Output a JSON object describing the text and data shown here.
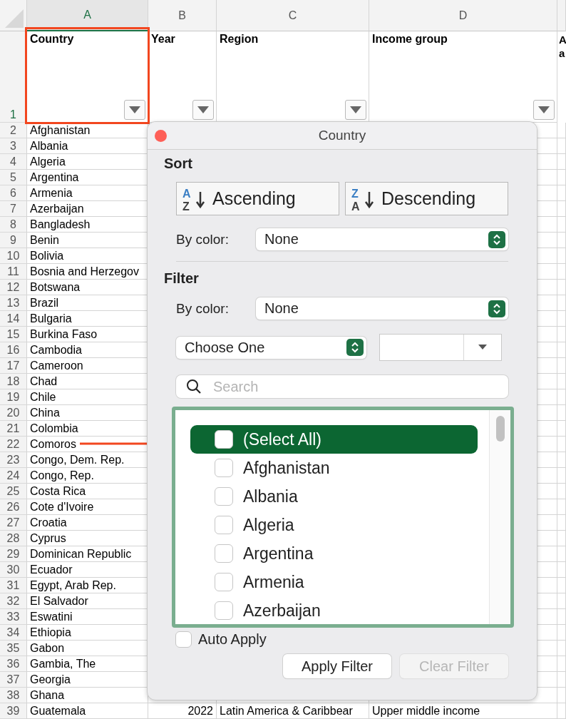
{
  "columns": [
    "A",
    "B",
    "C",
    "D"
  ],
  "header_row": {
    "number": "1",
    "cells": [
      "Country",
      "Year",
      "Region",
      "Income group"
    ],
    "column_5": "A a"
  },
  "rows": [
    {
      "number": "2",
      "country": "Afghanistan"
    },
    {
      "number": "3",
      "country": "Albania"
    },
    {
      "number": "4",
      "country": "Algeria"
    },
    {
      "number": "5",
      "country": "Argentina"
    },
    {
      "number": "6",
      "country": "Armenia"
    },
    {
      "number": "7",
      "country": "Azerbaijan"
    },
    {
      "number": "8",
      "country": "Bangladesh"
    },
    {
      "number": "9",
      "country": "Benin"
    },
    {
      "number": "10",
      "country": "Bolivia"
    },
    {
      "number": "11",
      "country": "Bosnia and Herzegov"
    },
    {
      "number": "12",
      "country": "Botswana"
    },
    {
      "number": "13",
      "country": "Brazil"
    },
    {
      "number": "14",
      "country": "Bulgaria"
    },
    {
      "number": "15",
      "country": "Burkina Faso"
    },
    {
      "number": "16",
      "country": "Cambodia"
    },
    {
      "number": "17",
      "country": "Cameroon"
    },
    {
      "number": "18",
      "country": "Chad"
    },
    {
      "number": "19",
      "country": "Chile"
    },
    {
      "number": "20",
      "country": "China"
    },
    {
      "number": "21",
      "country": "Colombia"
    },
    {
      "number": "22",
      "country": "Comoros"
    },
    {
      "number": "23",
      "country": "Congo, Dem. Rep."
    },
    {
      "number": "24",
      "country": "Congo, Rep."
    },
    {
      "number": "25",
      "country": "Costa Rica"
    },
    {
      "number": "26",
      "country": "Cote d'Ivoire"
    },
    {
      "number": "27",
      "country": "Croatia"
    },
    {
      "number": "28",
      "country": "Cyprus"
    },
    {
      "number": "29",
      "country": "Dominican Republic"
    },
    {
      "number": "30",
      "country": "Ecuador"
    },
    {
      "number": "31",
      "country": "Egypt, Arab Rep."
    },
    {
      "number": "32",
      "country": "El Salvador"
    },
    {
      "number": "33",
      "country": "Eswatini"
    },
    {
      "number": "34",
      "country": "Ethiopia"
    },
    {
      "number": "35",
      "country": "Gabon"
    },
    {
      "number": "36",
      "country": "Gambia, The"
    },
    {
      "number": "37",
      "country": "Georgia"
    },
    {
      "number": "38",
      "country": "Ghana"
    },
    {
      "number": "39",
      "country": "Guatemala",
      "year": "2022",
      "region": "Latin America & Caribbear",
      "income": "Upper middle income"
    }
  ],
  "filter_popup": {
    "title": "Country",
    "sort_label": "Sort",
    "ascending_icon": [
      "A",
      "Z"
    ],
    "ascending": "Ascending",
    "descending_icon": [
      "Z",
      "A"
    ],
    "descending": "Descending",
    "sort_by_color_label": "By color:",
    "sort_by_color_value": "None",
    "filter_label": "Filter",
    "filter_by_color_label": "By color:",
    "filter_by_color_value": "None",
    "condition": "Choose One",
    "search_placeholder": "Search",
    "items": [
      {
        "label": "(Select All)",
        "selected": true,
        "checked": false
      },
      {
        "label": "Afghanistan",
        "selected": false,
        "checked": false
      },
      {
        "label": "Albania",
        "selected": false,
        "checked": false
      },
      {
        "label": "Algeria",
        "selected": false,
        "checked": false
      },
      {
        "label": "Argentina",
        "selected": false,
        "checked": false
      },
      {
        "label": "Armenia",
        "selected": false,
        "checked": false
      },
      {
        "label": "Azerbaijan",
        "selected": false,
        "checked": false
      }
    ],
    "auto_apply": {
      "label": "Auto Apply",
      "checked": false
    },
    "apply_button": {
      "label": "Apply Filter",
      "disabled": false
    },
    "clear_button": {
      "label": "Clear Filter",
      "disabled": true
    }
  }
}
